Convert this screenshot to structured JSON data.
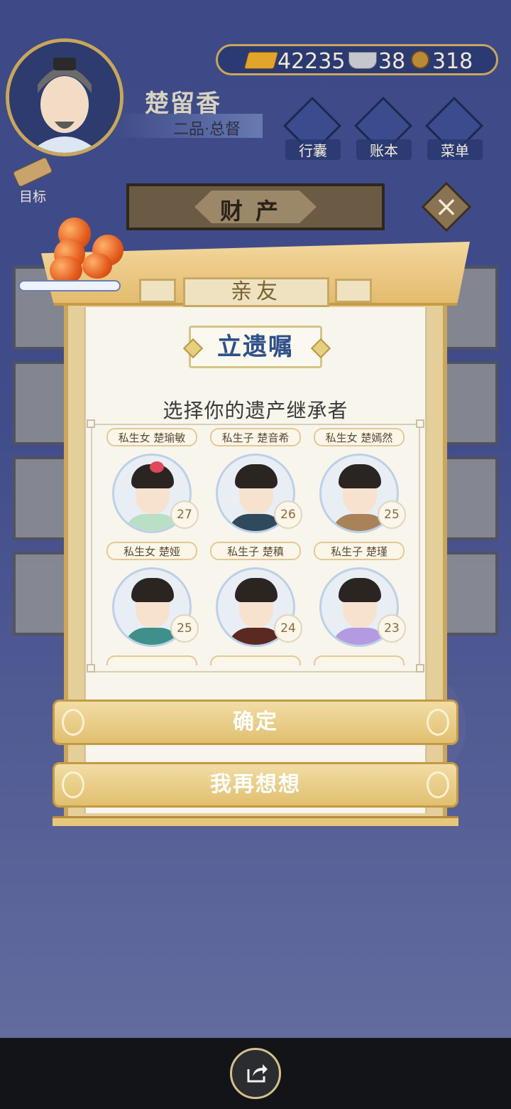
{
  "player": {
    "name": "楚留香",
    "rank": "二品·总督"
  },
  "currency": {
    "gold": "42235",
    "silver": "38",
    "coins": "318"
  },
  "top_menu": [
    {
      "label": "行囊"
    },
    {
      "label": "账本"
    },
    {
      "label": "菜单"
    }
  ],
  "goal_label": "目标",
  "banner_title": "财产",
  "panel": {
    "tab_title": "亲友",
    "will_title": "立遗嘱",
    "subtitle": "选择你的遗产继承者"
  },
  "heirs": [
    {
      "tag": "私生女 楚瑜敏",
      "age": "27"
    },
    {
      "tag": "私生子 楚音希",
      "age": "26"
    },
    {
      "tag": "私生女 楚嫣然",
      "age": "25"
    },
    {
      "tag": "私生女 楚娅",
      "age": "25"
    },
    {
      "tag": "私生子 楚稹",
      "age": "24"
    },
    {
      "tag": "私生子 楚瑾",
      "age": "23"
    }
  ],
  "buttons": {
    "confirm": "确定",
    "reconsider": "我再想想"
  },
  "colors": {
    "accent_gold": "#c9a65a",
    "title_blue": "#2e4f8a",
    "background": "#4b5ba0"
  }
}
